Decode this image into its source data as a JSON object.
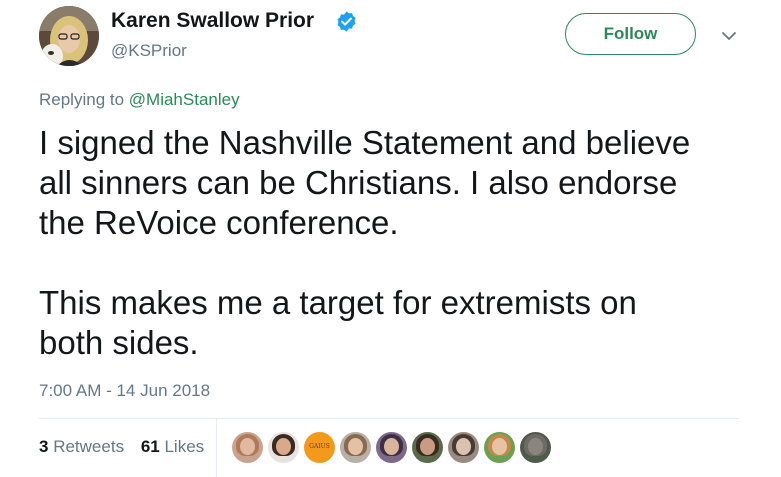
{
  "author": {
    "name": "Karen Swallow Prior",
    "handle": "@KSPrior",
    "avatar_icon": "profile-photo-icon",
    "verified_icon": "verified-badge-icon"
  },
  "follow_label": "Follow",
  "reply": {
    "prefix": "Replying to ",
    "mention": "@MiahStanley"
  },
  "tweet": {
    "text": "I signed the Nashville Statement and believe\nall sinners can be Christians. I also endorse\nthe ReVoice conference.\n\nThis makes me a target for extremists on\nboth sides."
  },
  "timestamp": "7:00 AM - 14 Jun 2018",
  "stats": {
    "retweets_count": "3",
    "retweets_label": "Retweets",
    "likes_count": "61",
    "likes_label": "Likes"
  },
  "liker_avatars": [
    {
      "bg": "#c9a38f",
      "hair": "#b07a5a",
      "face": "#e3b8a0",
      "text": ""
    },
    {
      "bg": "#e8e3de",
      "hair": "#3a2a22",
      "face": "#d9a98c",
      "text": ""
    },
    {
      "bg": "#f39a1c",
      "hair": "#f39a1c",
      "face": "#f39a1c",
      "text": "GAIUS"
    },
    {
      "bg": "#b7b0a6",
      "hair": "#8a6a4e",
      "face": "#e2c1a6",
      "text": ""
    },
    {
      "bg": "#7d6a8a",
      "hair": "#3d2f45",
      "face": "#d9b59c",
      "text": ""
    },
    {
      "bg": "#5a6a4a",
      "hair": "#3a2a20",
      "face": "#c99b82",
      "text": ""
    },
    {
      "bg": "#9a8a80",
      "hair": "#4a3a34",
      "face": "#d8c2b0",
      "text": ""
    },
    {
      "bg": "#6aa052",
      "hair": "#c08a4a",
      "face": "#e8c2a4",
      "text": ""
    },
    {
      "bg": "#4f5a4a",
      "hair": "#6e6a66",
      "face": "#8a857e",
      "text": ""
    }
  ],
  "colors": {
    "accent": "#2a8a5a",
    "verified": "#1da1f2",
    "text_primary": "#14171a",
    "text_secondary": "#657786"
  }
}
